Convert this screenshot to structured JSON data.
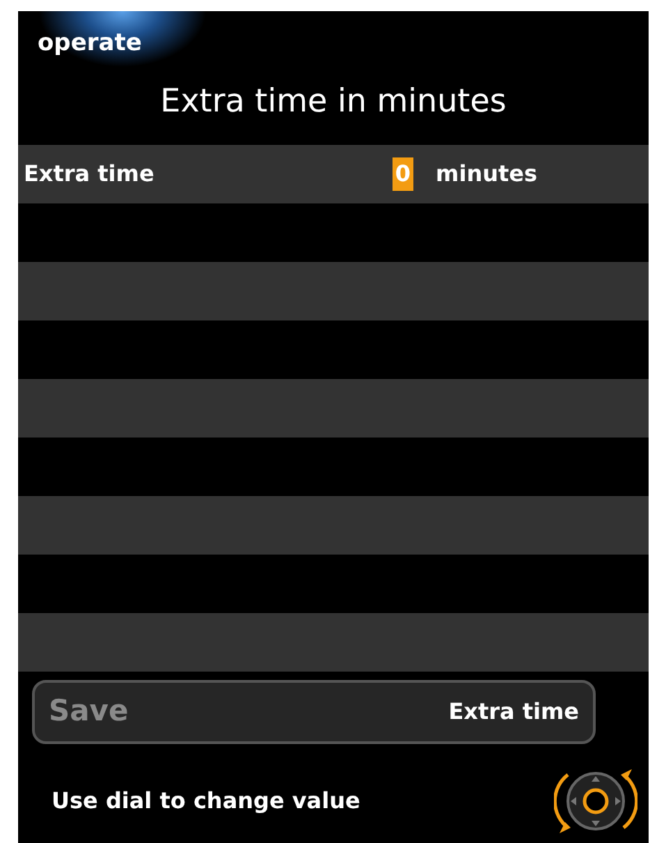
{
  "header": {
    "tab": "operate",
    "title": "Extra time in minutes"
  },
  "rows": [
    {
      "label": "Extra time",
      "value": "0",
      "unit": "minutes",
      "editing": true
    }
  ],
  "action_bar": {
    "button": "Save",
    "button_disabled": true,
    "context": "Extra time"
  },
  "hint": "Use dial to change value"
}
